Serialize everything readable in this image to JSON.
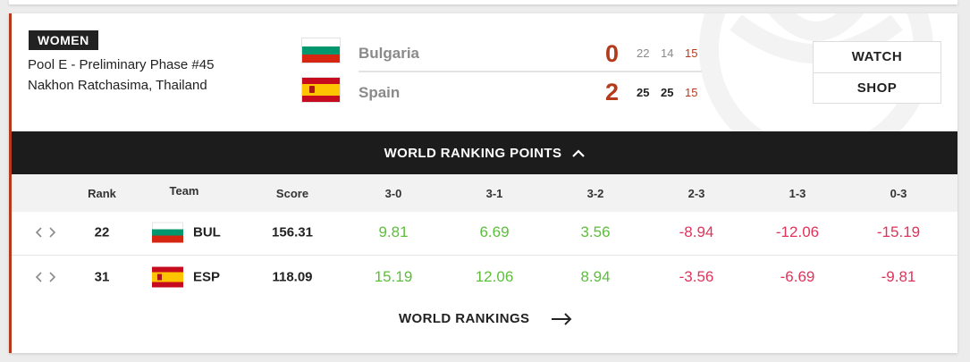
{
  "match": {
    "category": "WOMEN",
    "pool": "Pool E - Preliminary Phase #45",
    "venue": "Nakhon Ratchasima, Thailand",
    "teams": [
      {
        "name": "Bulgaria",
        "total": "0",
        "sets": [
          "22",
          "14",
          "15"
        ]
      },
      {
        "name": "Spain",
        "total": "2",
        "sets": [
          "25",
          "25",
          "15"
        ]
      }
    ]
  },
  "actions": {
    "watch": "WATCH",
    "shop": "SHOP"
  },
  "ranking_points": {
    "title": "WORLD RANKING POINTS",
    "headers": [
      "Rank",
      "Team",
      "Score",
      "3-0",
      "3-1",
      "3-2",
      "2-3",
      "1-3",
      "0-3"
    ],
    "rows": [
      {
        "rank": "22",
        "team": "BUL",
        "score": "156.31",
        "values": [
          "9.81",
          "6.69",
          "3.56",
          "-8.94",
          "-12.06",
          "-15.19"
        ]
      },
      {
        "rank": "31",
        "team": "ESP",
        "score": "118.09",
        "values": [
          "15.19",
          "12.06",
          "8.94",
          "-3.56",
          "-6.69",
          "-9.81"
        ]
      }
    ]
  },
  "footer_link": "WORLD RANKINGS",
  "colors": {
    "accent": "#b43a1b",
    "positive": "#5cbf3a",
    "negative": "#e0335a",
    "bar": "#1c1c1c"
  }
}
